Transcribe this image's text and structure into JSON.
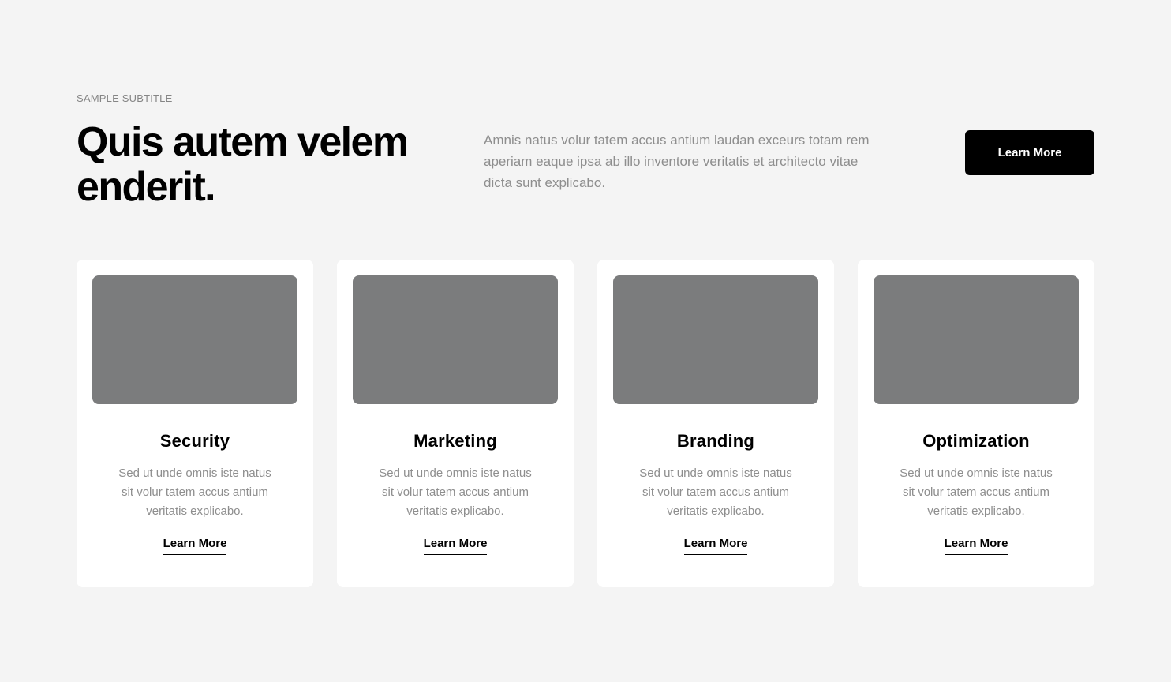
{
  "header": {
    "subtitle": "SAMPLE SUBTITLE",
    "headline": "Quis autem velem enderit.",
    "intro": "Amnis natus volur tatem accus antium laudan exceurs totam rem aperiam eaque ipsa ab illo inventore veritatis et architecto vitae dicta sunt explicabo.",
    "cta_label": "Learn More"
  },
  "cards": [
    {
      "title": "Security",
      "text": "Sed ut unde omnis iste natus sit volur tatem accus antium veritatis explicabo.",
      "link_label": "Learn More"
    },
    {
      "title": "Marketing",
      "text": "Sed ut unde omnis iste natus sit volur tatem accus antium veritatis explicabo.",
      "link_label": "Learn More"
    },
    {
      "title": "Branding",
      "text": "Sed ut unde omnis iste natus sit volur tatem accus antium veritatis explicabo.",
      "link_label": "Learn More"
    },
    {
      "title": "Optimization",
      "text": "Sed ut unde omnis iste natus sit volur tatem accus antium veritatis explicabo.",
      "link_label": "Learn More"
    }
  ],
  "colors": {
    "background": "#f4f4f4",
    "card_background": "#ffffff",
    "image_placeholder": "#7b7c7d",
    "muted_text": "#8e8e8e",
    "accent": "#000000"
  }
}
